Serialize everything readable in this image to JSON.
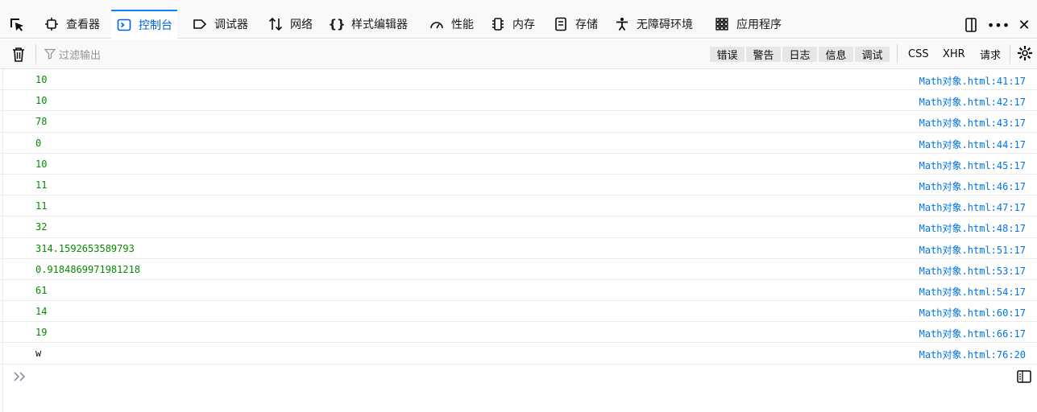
{
  "tabs": [
    {
      "id": "inspector",
      "label": "查看器",
      "icon": "inspector-icon"
    },
    {
      "id": "console",
      "label": "控制台",
      "icon": "console-icon",
      "selected": true
    },
    {
      "id": "debugger",
      "label": "调试器",
      "icon": "debugger-icon"
    },
    {
      "id": "network",
      "label": "网络",
      "icon": "network-icon"
    },
    {
      "id": "style-editor",
      "label": "样式编辑器",
      "icon": "braces-icon"
    },
    {
      "id": "performance",
      "label": "性能",
      "icon": "gauge-icon"
    },
    {
      "id": "memory",
      "label": "内存",
      "icon": "memory-chip-icon"
    },
    {
      "id": "storage",
      "label": "存储",
      "icon": "storage-icon"
    },
    {
      "id": "accessibility",
      "label": "无障碍环境",
      "icon": "accessibility-icon"
    },
    {
      "id": "application",
      "label": "应用程序",
      "icon": "grid-icon"
    }
  ],
  "right_controls": {
    "more": "•••",
    "close": "✕"
  },
  "toolbar": {
    "filter_placeholder": "过滤输出",
    "levels": [
      "错误",
      "警告",
      "日志",
      "信息",
      "调试"
    ],
    "extra": [
      "CSS",
      "XHR",
      "请求"
    ]
  },
  "log_entries": [
    {
      "value": "10",
      "location": "Math对象.html:41:17",
      "type": "number"
    },
    {
      "value": "10",
      "location": "Math对象.html:42:17",
      "type": "number"
    },
    {
      "value": "78",
      "location": "Math对象.html:43:17",
      "type": "number"
    },
    {
      "value": "0",
      "location": "Math对象.html:44:17",
      "type": "number"
    },
    {
      "value": "10",
      "location": "Math对象.html:45:17",
      "type": "number"
    },
    {
      "value": "11",
      "location": "Math对象.html:46:17",
      "type": "number"
    },
    {
      "value": "11",
      "location": "Math对象.html:47:17",
      "type": "number"
    },
    {
      "value": "32",
      "location": "Math对象.html:48:17",
      "type": "number"
    },
    {
      "value": "314.1592653589793",
      "location": "Math对象.html:51:17",
      "type": "number"
    },
    {
      "value": "0.9184869971981218",
      "location": "Math对象.html:53:17",
      "type": "number"
    },
    {
      "value": "61",
      "location": "Math对象.html:54:17",
      "type": "number"
    },
    {
      "value": "14",
      "location": "Math对象.html:60:17",
      "type": "number"
    },
    {
      "value": "19",
      "location": "Math对象.html:66:17",
      "type": "number"
    },
    {
      "value": "w",
      "location": "Math对象.html:76:20",
      "type": "string"
    }
  ],
  "colors": {
    "accent": "#0a84ff",
    "number": "#058b00",
    "link": "#0074e8"
  }
}
